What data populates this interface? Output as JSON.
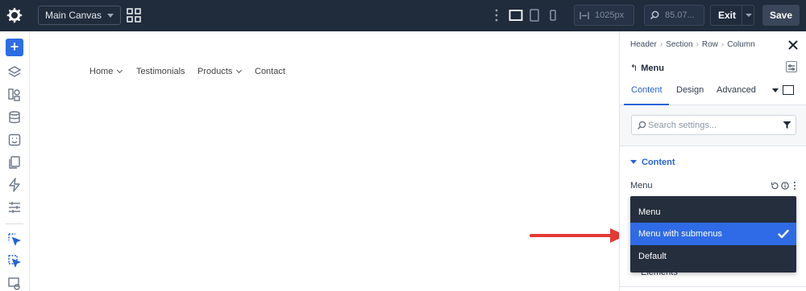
{
  "topbar": {
    "canvas_select": "Main Canvas",
    "width_value": "1025px",
    "zoom_value": "85.07...",
    "exit_label": "Exit",
    "save_label": "Save"
  },
  "canvas": {
    "nav_items": [
      {
        "label": "Home",
        "has_submenu": true
      },
      {
        "label": "Testimonials",
        "has_submenu": false
      },
      {
        "label": "Products",
        "has_submenu": true
      },
      {
        "label": "Contact",
        "has_submenu": false
      }
    ]
  },
  "panel": {
    "breadcrumb": [
      "Header",
      "Section",
      "Row",
      "Column"
    ],
    "title": "Menu",
    "tabs": [
      "Content",
      "Design",
      "Advanced"
    ],
    "active_tab": "Content",
    "search_placeholder": "Search settings...",
    "section_label": "Content",
    "field_label": "Menu",
    "partial_label": "Elements"
  },
  "dropdown": {
    "options": [
      "Menu",
      "Menu with submenus",
      "Default"
    ],
    "selected": "Menu with submenus"
  },
  "colors": {
    "topbar_bg": "#202b3c",
    "accent": "#2563d8",
    "dropdown_bg": "#242e3d",
    "selected_bg": "#2f6be6",
    "arrow": "#e53935"
  }
}
